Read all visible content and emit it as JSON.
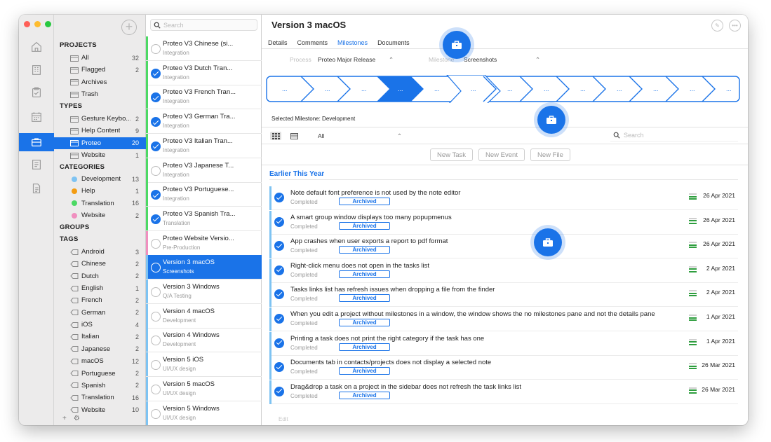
{
  "window": {
    "traffic_colors": [
      "#fe5f57",
      "#febc2e",
      "#28c840"
    ]
  },
  "rail": {
    "icons": [
      "home-icon",
      "building-icon",
      "clipboard-icon",
      "calendar-icon",
      "briefcase-icon",
      "notes-icon",
      "document-icon"
    ],
    "active": "briefcase-icon"
  },
  "sidebar": {
    "projects_header": "PROJECTS",
    "projects": [
      {
        "label": "All",
        "count": "32",
        "icon": "folder-icon"
      },
      {
        "label": "Flagged",
        "count": "2",
        "icon": "flag-icon"
      },
      {
        "label": "Archives",
        "count": "",
        "icon": "archive-icon"
      },
      {
        "label": "Trash",
        "count": "",
        "icon": "trash-icon"
      }
    ],
    "types_header": "TYPES",
    "types": [
      {
        "label": "Gesture Keybo...",
        "count": "2"
      },
      {
        "label": "Help Content",
        "count": "9"
      },
      {
        "label": "Proteo",
        "count": "20",
        "selected": true
      },
      {
        "label": "Website",
        "count": "1"
      }
    ],
    "categories_header": "CATEGORIES",
    "categories": [
      {
        "label": "Development",
        "count": "13",
        "color": "#7ec3f2"
      },
      {
        "label": "Help",
        "count": "1",
        "color": "#f39c12"
      },
      {
        "label": "Translation",
        "count": "16",
        "color": "#4cd964"
      },
      {
        "label": "Website",
        "count": "2",
        "color": "#f08fbf"
      }
    ],
    "groups_header": "GROUPS",
    "tags_header": "TAGS",
    "tags": [
      {
        "label": "Android",
        "count": "3"
      },
      {
        "label": "Chinese",
        "count": "2"
      },
      {
        "label": "Dutch",
        "count": "2"
      },
      {
        "label": "English",
        "count": "1"
      },
      {
        "label": "French",
        "count": "2"
      },
      {
        "label": "German",
        "count": "2"
      },
      {
        "label": "iOS",
        "count": "4"
      },
      {
        "label": "Italian",
        "count": "2"
      },
      {
        "label": "Japanese",
        "count": "2"
      },
      {
        "label": "macOS",
        "count": "12"
      },
      {
        "label": "Portuguese",
        "count": "2"
      },
      {
        "label": "Spanish",
        "count": "2"
      },
      {
        "label": "Translation",
        "count": "16"
      },
      {
        "label": "Website",
        "count": "10"
      }
    ],
    "bottom": {
      "add": "+",
      "settings": "⚙"
    }
  },
  "project_list": {
    "search_placeholder": "Search",
    "items": [
      {
        "title": "Proteo V3 Chinese (si...",
        "subtitle": "Integration",
        "checked": false,
        "bar": "#4cd964"
      },
      {
        "title": "Proteo V3 Dutch Tran...",
        "subtitle": "Integration",
        "checked": true,
        "bar": "#4cd964"
      },
      {
        "title": "Proteo V3 French Tran...",
        "subtitle": "Integration",
        "checked": true,
        "bar": "#4cd964"
      },
      {
        "title": "Proteo V3 German Tra...",
        "subtitle": "Integration",
        "checked": true,
        "bar": "#4cd964"
      },
      {
        "title": "Proteo V3 Italian Tran...",
        "subtitle": "Integration",
        "checked": true,
        "bar": "#4cd964"
      },
      {
        "title": "Proteo V3 Japanese T...",
        "subtitle": "Integration",
        "checked": false,
        "bar": "#4cd964"
      },
      {
        "title": "Proteo V3 Portuguese...",
        "subtitle": "Integration",
        "checked": true,
        "bar": "#4cd964"
      },
      {
        "title": "Proteo V3 Spanish Tra...",
        "subtitle": "Translation",
        "checked": true,
        "bar": "#4cd964"
      },
      {
        "title": "Proteo Website Versio...",
        "subtitle": "Pre-Production",
        "checked": false,
        "bar": "#f08fbf"
      },
      {
        "title": "Version 3 macOS",
        "subtitle": "Screenshots",
        "checked": false,
        "bar": "#7ec3f2",
        "selected": true
      },
      {
        "title": "Version 3 Windows",
        "subtitle": "Q/A Testing",
        "checked": false,
        "bar": "#7ec3f2"
      },
      {
        "title": "Version 4 macOS",
        "subtitle": "Development",
        "checked": false,
        "bar": "#7ec3f2"
      },
      {
        "title": "Version 4 Windows",
        "subtitle": "Development",
        "checked": false,
        "bar": "#7ec3f2"
      },
      {
        "title": "Version 5 iOS",
        "subtitle": "UI/UX design",
        "checked": false,
        "bar": "#7ec3f2"
      },
      {
        "title": "Version 5 macOS",
        "subtitle": "UI/UX design",
        "checked": false,
        "bar": "#7ec3f2"
      },
      {
        "title": "Version 5 Windows",
        "subtitle": "UI/UX design",
        "checked": false,
        "bar": "#7ec3f2"
      }
    ]
  },
  "main": {
    "title": "Version 3 macOS",
    "tabs": [
      "Details",
      "Comments",
      "Milestones",
      "Documents"
    ],
    "active_tab": "Milestones",
    "process_label": "Process",
    "process_value": "Proteo Major Release",
    "milestone_label": "Milestone",
    "milestone_value": "Screenshots",
    "chevrons": [
      "...",
      "...",
      "...",
      "...",
      "...",
      "...",
      "...",
      "...",
      "...",
      "...",
      "...",
      "...",
      "..."
    ],
    "chevron_filled_index": 3,
    "chevron_current_index": 5,
    "selected_milestone": "Selected Milestone: Development",
    "filter_value": "All",
    "search_placeholder": "Search",
    "buttons": {
      "new_task": "New Task",
      "new_event": "New Event",
      "new_file": "New File"
    },
    "section_title": "Earlier This Year",
    "tasks": [
      {
        "title": "Note default font preference is not used by the note editor",
        "status": "Completed",
        "badge": "Archived",
        "date": "26 Apr 2021"
      },
      {
        "title": "A smart group window displays too many popupmenus",
        "status": "Completed",
        "badge": "Archived",
        "date": "26 Apr 2021"
      },
      {
        "title": "App crashes when user exports a report to pdf format",
        "status": "Completed",
        "badge": "Archived",
        "date": "26 Apr 2021"
      },
      {
        "title": "Right-click menu does not open in the tasks list",
        "status": "Completed",
        "badge": "Archived",
        "date": "2 Apr 2021"
      },
      {
        "title": "Tasks links list has refresh issues when dropping a file from the finder",
        "status": "Completed",
        "badge": "Archived",
        "date": "2 Apr 2021"
      },
      {
        "title": "When you edit a project without milestones in a window, the window shows the no milestones pane and not the details pane",
        "status": "Completed",
        "badge": "Archived",
        "date": "1 Apr 2021"
      },
      {
        "title": "Printing a task does not print the right category if the task has one",
        "status": "Completed",
        "badge": "Archived",
        "date": "1 Apr 2021"
      },
      {
        "title": "Documents tab in contacts/projects does not display a selected note",
        "status": "Completed",
        "badge": "Archived",
        "date": "26 Mar 2021"
      },
      {
        "title": "Drag&drop a task on a project in the sidebar does not refresh the task links list",
        "status": "Completed",
        "badge": "Archived",
        "date": "26 Mar 2021"
      }
    ],
    "edit_label": "Edit"
  },
  "accent": "#1a73e8"
}
